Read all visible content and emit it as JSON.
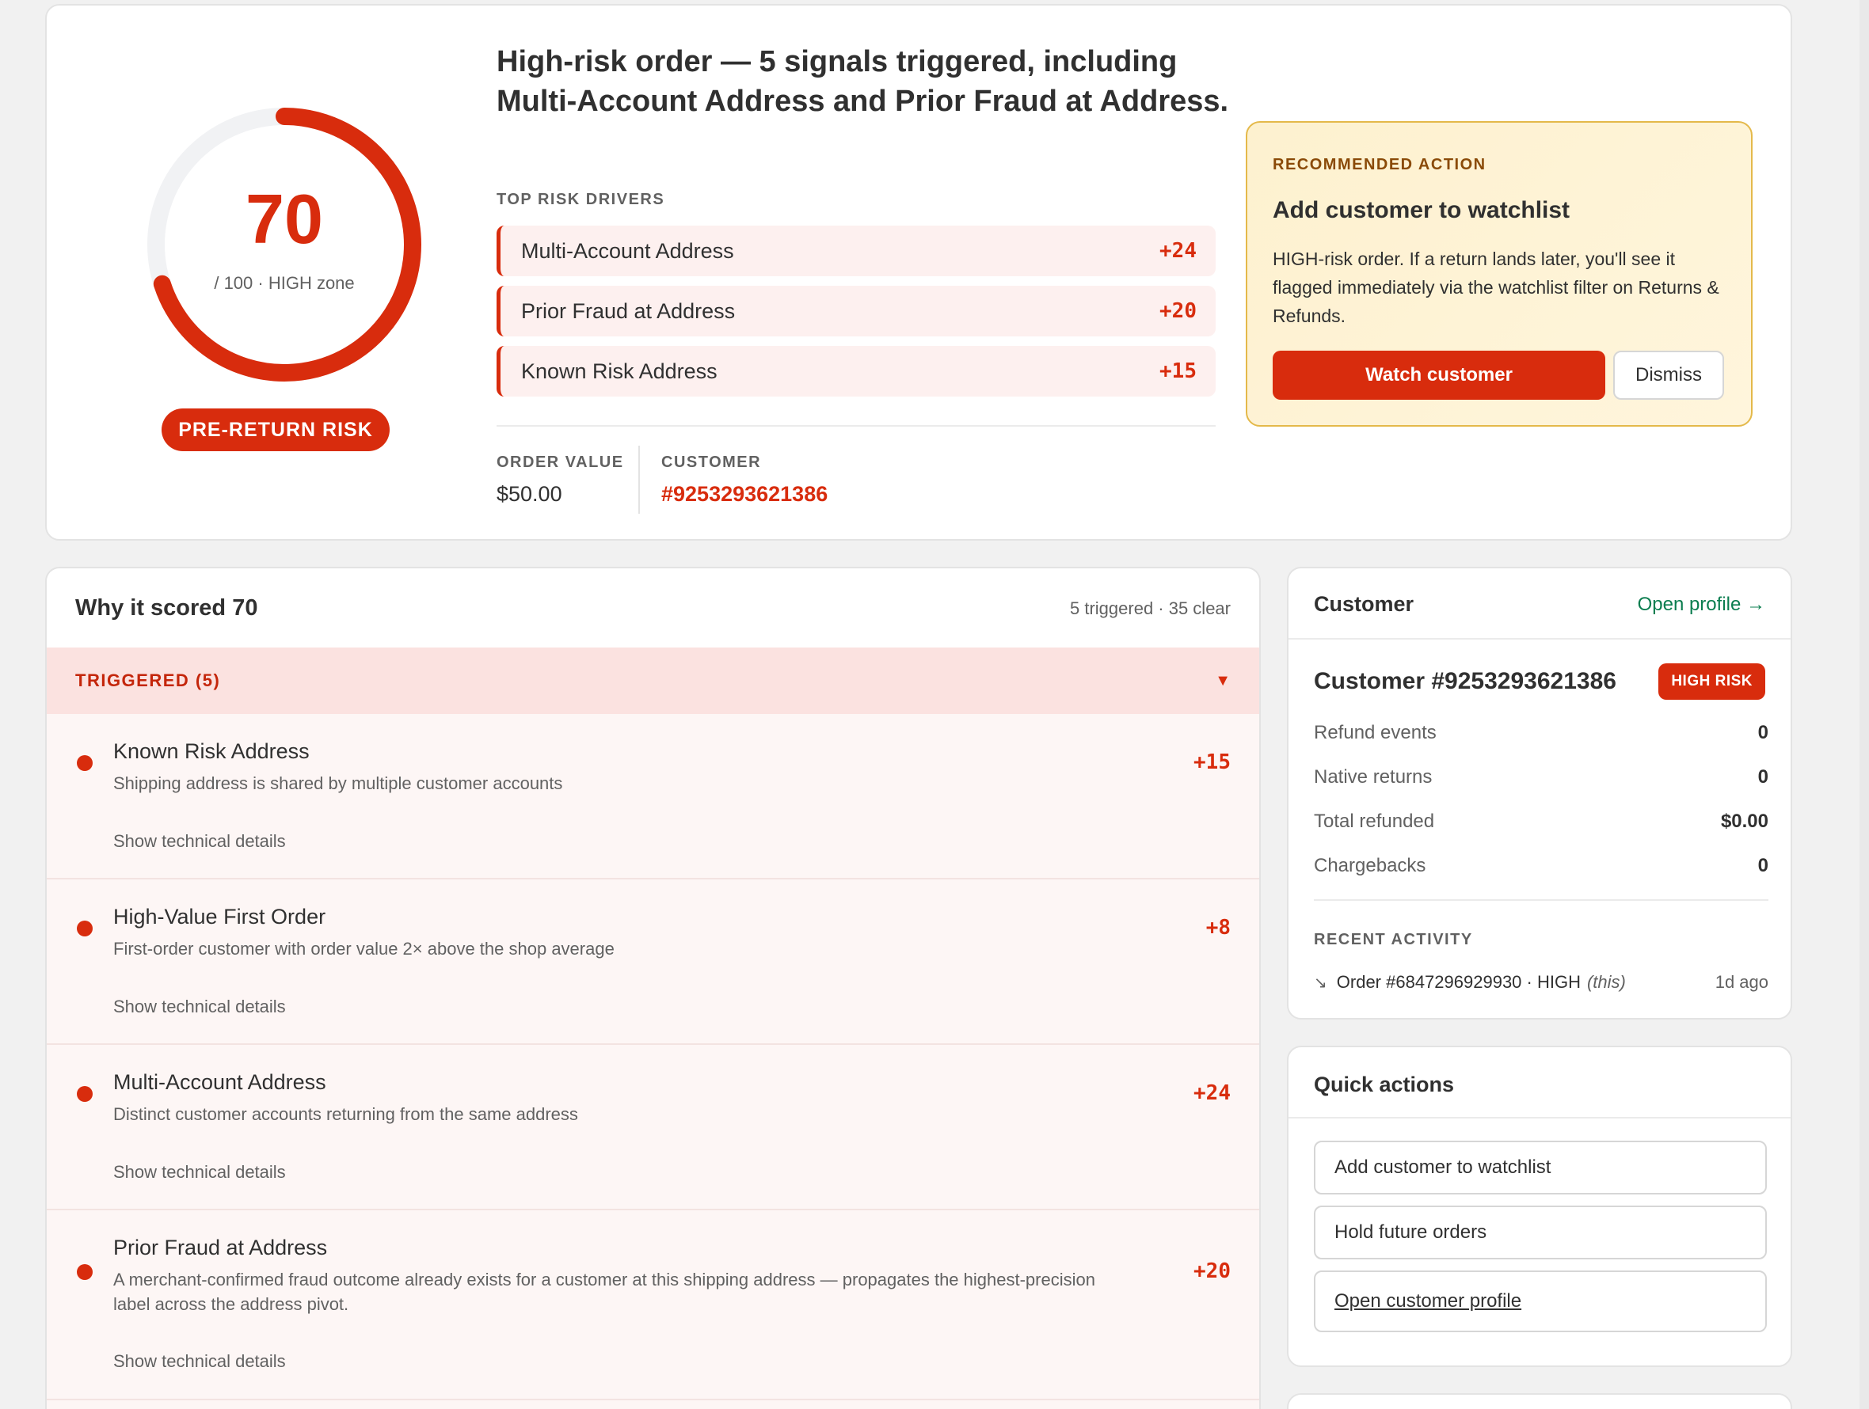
{
  "hero": {
    "score": "70",
    "score_sub": "/ 100 · HIGH zone",
    "score_fraction": 0.7,
    "pill": "PRE-RETURN RISK",
    "title": "High-risk order — 5 signals triggered, including Multi-Account Address and Prior Fraud at Address.",
    "drivers_label": "TOP RISK DRIVERS",
    "drivers": [
      {
        "name": "Multi-Account Address",
        "points": "+24"
      },
      {
        "name": "Prior Fraud at Address",
        "points": "+20"
      },
      {
        "name": "Known Risk Address",
        "points": "+15"
      }
    ],
    "order_value_label": "ORDER VALUE",
    "order_value": "$50.00",
    "customer_label": "CUSTOMER",
    "customer_id": "#9253293621386"
  },
  "recommended": {
    "label": "RECOMMENDED ACTION",
    "title": "Add customer to watchlist",
    "body": "HIGH-risk order. If a return lands later, you'll see it flagged immediately via the watchlist filter on Returns & Refunds.",
    "primary_button": "Watch customer",
    "secondary_button": "Dismiss"
  },
  "why": {
    "title": "Why it scored 70",
    "count": "5 triggered · 35 clear",
    "triggered_label": "TRIGGERED (5)",
    "caret": "▼",
    "signals": [
      {
        "name": "Known Risk Address",
        "desc": "Shipping address is shared by multiple customer accounts",
        "points": "+15",
        "link": "Show technical details"
      },
      {
        "name": "High-Value First Order",
        "desc": "First-order customer with order value 2× above the shop average",
        "points": "+8",
        "link": "Show technical details"
      },
      {
        "name": "Multi-Account Address",
        "desc": "Distinct customer accounts returning from the same address",
        "points": "+24",
        "link": "Show technical details"
      },
      {
        "name": "Prior Fraud at Address",
        "desc": "A merchant-confirmed fraud outcome already exists for a customer at this shipping address — propagates the highest-precision label across the address pivot.",
        "points": "+20",
        "link": "Show technical details"
      }
    ]
  },
  "customer": {
    "title": "Customer",
    "open_profile": "Open profile →",
    "name": "Customer #9253293621386",
    "badge": "HIGH RISK",
    "stats": [
      {
        "label": "Refund events",
        "value": "0"
      },
      {
        "label": "Native returns",
        "value": "0"
      },
      {
        "label": "Total refunded",
        "value": "$0.00"
      },
      {
        "label": "Chargebacks",
        "value": "0"
      }
    ],
    "recent_label": "RECENT ACTIVITY",
    "activity": {
      "arrow": "↘",
      "order": "Order #6847296929930 · HIGH",
      "note": "(this)",
      "ago": "1d ago"
    }
  },
  "quick_actions": {
    "title": "Quick actions",
    "buttons": [
      "Add customer to watchlist",
      "Hold future orders",
      "Open customer profile"
    ]
  },
  "colors": {
    "accent": "#d82c0d",
    "accent_soft": "#fdf0ef",
    "warning_bg": "#fdf1cf",
    "success_link": "#0a7d4f"
  }
}
